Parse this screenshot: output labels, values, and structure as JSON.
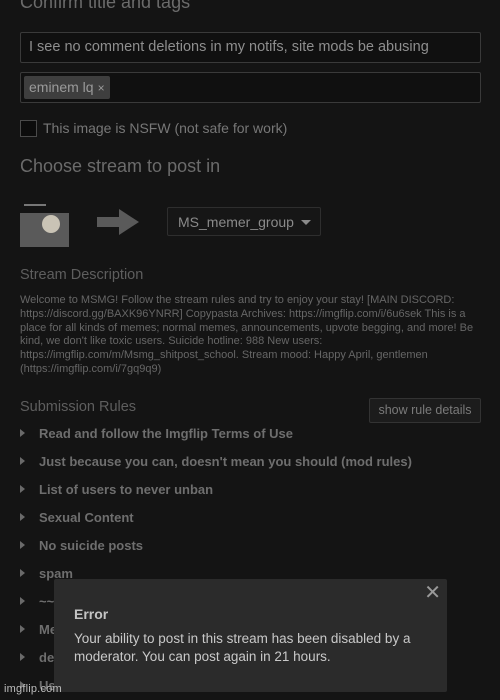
{
  "confirm_section": {
    "title": "Confirm title and tags"
  },
  "title_input": {
    "value": "I see no comment deletions in my notifs, site mods be abusing"
  },
  "tags": [
    {
      "label": "eminem lq",
      "remove": "×"
    }
  ],
  "nsfw": {
    "label": "This image is NSFW (not safe for work)",
    "checked": false
  },
  "stream_section": {
    "title": "Choose stream to post in"
  },
  "stream_select": {
    "value": "MS_memer_group"
  },
  "stream_description": {
    "title": "Stream Description",
    "text": "Welcome to MSMG! Follow the stream rules and try to enjoy your stay! [MAIN DISCORD: https://discord.gg/BAXK96YNRR] Copypasta Archives: https://imgflip.com/i/6u6sek This is a place for all kinds of memes; normal memes, announcements, upvote begging, and more! Be kind, we don't like toxic users. Suicide hotline: 988 New users: https://imgflip.com/m/Msmg_shitpost_school. Stream mood: Happy April, gentlemen (https://imgflip.com/i/7gq9q9)"
  },
  "submission_rules": {
    "title": "Submission Rules",
    "details_button": "show rule details",
    "items": [
      "Read and follow the Imgflip Terms of Use",
      "Just because you can, doesn't mean you should (mod rules)",
      "List of users to never unban",
      "Sexual Content",
      "No suicide posts",
      "spam",
      "~~",
      "Me",
      "de",
      "Us"
    ]
  },
  "error_modal": {
    "close": "✕",
    "title": "Error",
    "message": "Your ability to post in this stream has been disabled by a moderator. You can post again in 21 hours."
  },
  "watermark": "imgflip.com",
  "colors": {
    "background": "#141414",
    "modal": "#2b2b2b"
  }
}
